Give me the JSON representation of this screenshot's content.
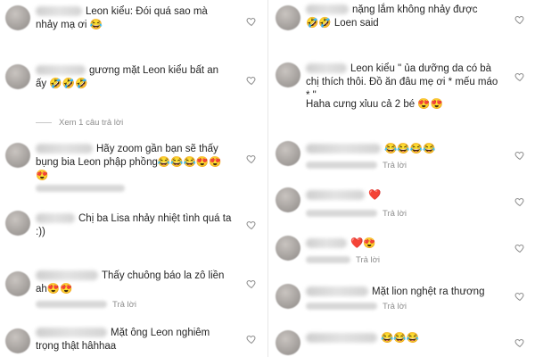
{
  "left": [
    {
      "text": "Leon kiểu: Đói quá sao mà nhảy mạ ơi 😂",
      "meta": ""
    },
    {
      "text": "gương mặt Leon kiểu bất an ấy 🤣🤣🤣",
      "meta": ""
    },
    {
      "text": "Xem 1 câu trả lời",
      "meta": ""
    },
    {
      "text": "Hãy zoom gần bạn sẽ thấy bụng bia Leon phập phồng😂😂😂😍😍😍",
      "meta": ""
    },
    {
      "text": "Chị ba Lisa nhảy nhiệt tình quá ta :))",
      "meta": ""
    },
    {
      "text": "Thấy chuông báo la zô liền ah😍😍",
      "meta": "Trả lời"
    },
    {
      "text": "Mặt ông Leon nghiêm trọng thật hâhhaa",
      "meta": ""
    }
  ],
  "right": [
    {
      "text": "nặng lắm không nhảy được 🤣🤣 Loen said",
      "meta": ""
    },
    {
      "text": "Leon kiểu \" ủa dưỡng da có bà chị thích thôi. Đồ ăn đâu mẹ ơi * mếu máo * \"",
      "meta": ""
    },
    {
      "text": "Haha cưng xỉuu cả 2 bé 😍😍",
      "meta": ""
    },
    {
      "text": "😂😂😂😂",
      "meta": "Trả lời"
    },
    {
      "text": "❤️",
      "meta": "Trả lời"
    },
    {
      "text": "❤️😍",
      "meta": "Trả lời"
    },
    {
      "text": "Mặt lion nghệt ra thương",
      "meta": "Trả lời"
    },
    {
      "text": "😂😂😂",
      "meta": ""
    }
  ],
  "icons": {
    "like": "heart-outline-icon"
  },
  "colors": {
    "text": "#262626",
    "meta": "#8e8e8e",
    "heart_red": "#ed4956"
  }
}
